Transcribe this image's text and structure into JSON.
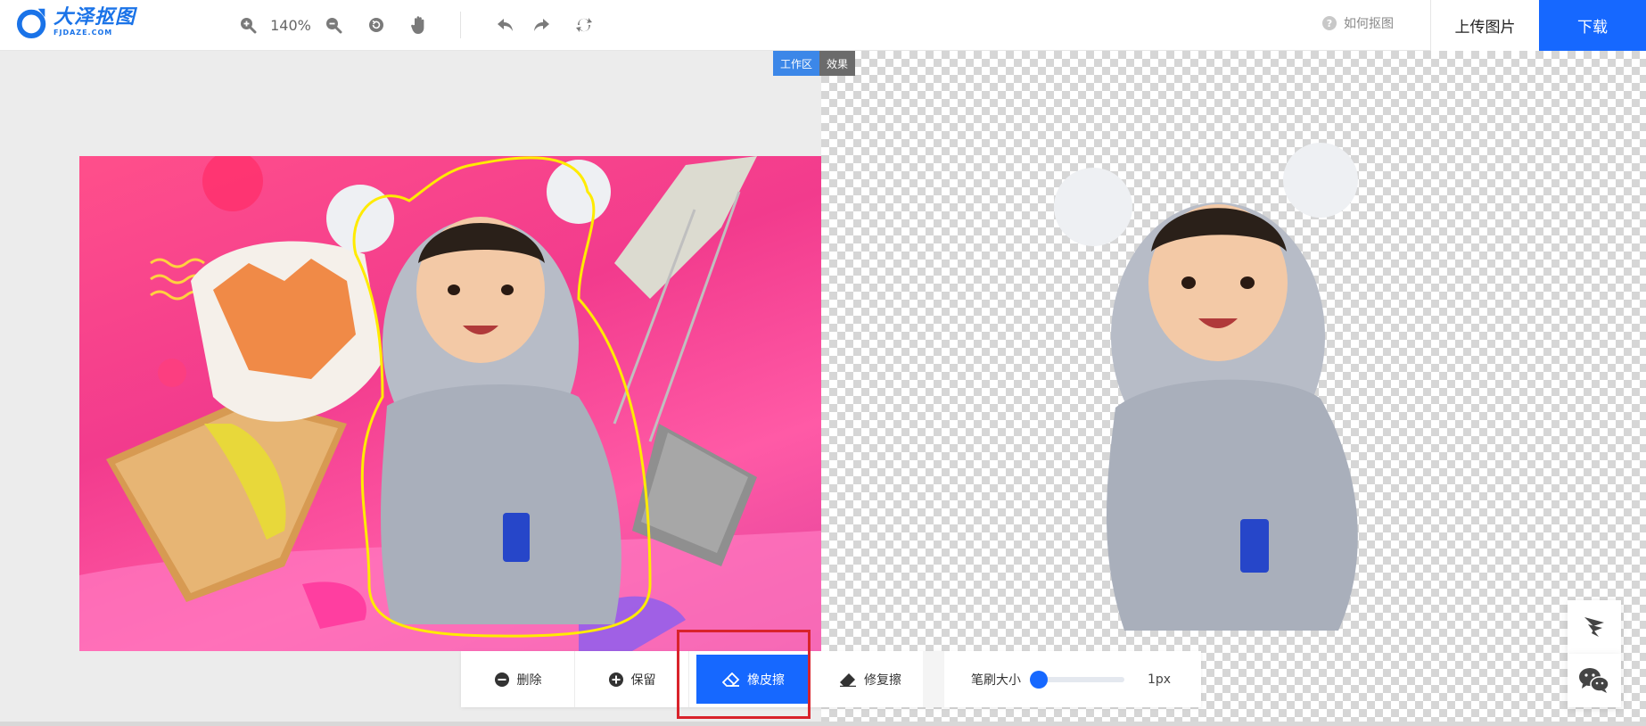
{
  "header": {
    "logo_cn": "大泽抠图",
    "logo_en": "FJDAZE.COM",
    "zoom_level": "140%",
    "help_text": "如何抠图",
    "upload_label": "上传图片",
    "download_label": "下载"
  },
  "workspace": {
    "tab_work": "工作区",
    "tab_effect": "效果"
  },
  "bottom_toolbar": {
    "delete_label": "删除",
    "keep_label": "保留",
    "eraser_label": "橡皮擦",
    "restore_label": "修复擦",
    "brush_label": "笔刷大小",
    "brush_value": "1px",
    "brush_level": 0
  },
  "colors": {
    "accent": "#1668ff",
    "tab_active": "#3c87e8",
    "highlight": "#d9232b",
    "selection_outline": "#ffeb00"
  },
  "icons": {
    "zoom_in": "zoom-in-icon",
    "zoom_out": "zoom-out-icon",
    "reset": "reset-icon",
    "pan": "hand-icon",
    "undo": "undo-icon",
    "redo": "redo-icon",
    "swap": "swap-icon",
    "help": "help-icon",
    "delete": "minus-circle-icon",
    "keep": "plus-circle-icon",
    "eraser": "eraser-icon",
    "restore": "restore-brush-icon",
    "feedback": "feedback-icon",
    "wechat": "wechat-icon"
  }
}
